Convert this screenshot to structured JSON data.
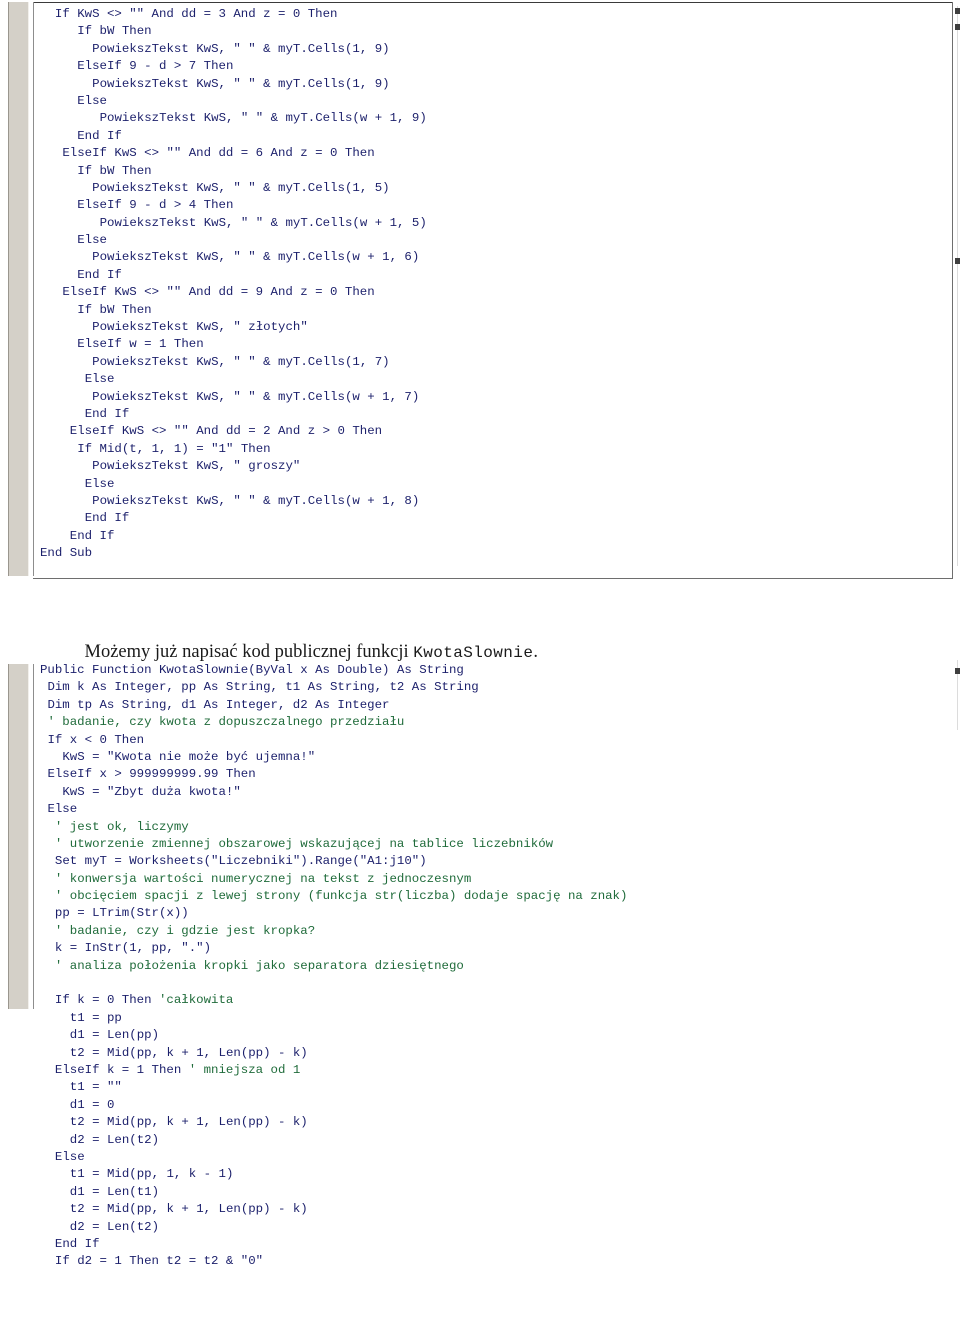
{
  "document": {
    "kind": "scanned-page",
    "language": "pl",
    "background_color": "#ffffff",
    "margin_strip_color": "#d4d0c8",
    "code_color": "#16195c",
    "comment_color": "#1f6b3a"
  },
  "code_block_1": {
    "name": "vba-listing-kwota-slownie-tail",
    "language": "VBA",
    "lines": [
      [
        {
          "t": "If KwS <> \"\" And dd = 3 And z = 0 Then",
          "c": "kw",
          "indent": 2
        }
      ],
      [
        {
          "t": "If bW Then",
          "c": "kw",
          "indent": 5
        }
      ],
      [
        {
          "t": "PowiekszTekst KwS, \" \" & myT.Cells(1, 9)",
          "c": "plain",
          "indent": 7
        }
      ],
      [
        {
          "t": "ElseIf 9 - d > 7 Then",
          "c": "kw",
          "indent": 5
        }
      ],
      [
        {
          "t": "PowiekszTekst KwS, \" \" & myT.Cells(1, 9)",
          "c": "plain",
          "indent": 7
        }
      ],
      [
        {
          "t": "Else",
          "c": "kw",
          "indent": 5
        }
      ],
      [
        {
          "t": "PowiekszTekst KwS, \" \" & myT.Cells(w + 1, 9)",
          "c": "plain",
          "indent": 8
        }
      ],
      [
        {
          "t": "End If",
          "c": "kw",
          "indent": 5
        }
      ],
      [
        {
          "t": "ElseIf KwS <> \"\" And dd = 6 And z = 0 Then",
          "c": "kw",
          "indent": 3
        }
      ],
      [
        {
          "t": "If bW Then",
          "c": "kw",
          "indent": 5
        }
      ],
      [
        {
          "t": "PowiekszTekst KwS, \" \" & myT.Cells(1, 5)",
          "c": "plain",
          "indent": 7
        }
      ],
      [
        {
          "t": "ElseIf 9 - d > 4 Then",
          "c": "kw",
          "indent": 5
        }
      ],
      [
        {
          "t": "PowiekszTekst KwS, \" \" & myT.Cells(w + 1, 5)",
          "c": "plain",
          "indent": 8
        }
      ],
      [
        {
          "t": "Else",
          "c": "kw",
          "indent": 5
        }
      ],
      [
        {
          "t": "PowiekszTekst KwS, \" \" & myT.Cells(w + 1, 6)",
          "c": "plain",
          "indent": 7
        }
      ],
      [
        {
          "t": "End If",
          "c": "kw",
          "indent": 5
        }
      ],
      [
        {
          "t": "ElseIf KwS <> \"\" And dd = 9 And z = 0 Then",
          "c": "kw",
          "indent": 3
        }
      ],
      [
        {
          "t": "If bW Then",
          "c": "kw",
          "indent": 5
        }
      ],
      [
        {
          "t": "PowiekszTekst KwS, \" złotych\"",
          "c": "plain",
          "indent": 7
        }
      ],
      [
        {
          "t": "ElseIf w = 1 Then",
          "c": "kw",
          "indent": 5
        }
      ],
      [
        {
          "t": "PowiekszTekst KwS, \" \" & myT.Cells(1, 7)",
          "c": "plain",
          "indent": 7
        }
      ],
      [
        {
          "t": "Else",
          "c": "kw",
          "indent": 6
        }
      ],
      [
        {
          "t": "PowiekszTekst KwS, \" \" & myT.Cells(w + 1, 7)",
          "c": "plain",
          "indent": 7
        }
      ],
      [
        {
          "t": "End If",
          "c": "kw",
          "indent": 6
        }
      ],
      [
        {
          "t": "ElseIf KwS <> \"\" And dd = 2 And z > 0 Then",
          "c": "kw",
          "indent": 4
        }
      ],
      [
        {
          "t": "If Mid(t, 1, 1) = \"1\" Then",
          "c": "kw",
          "indent": 5
        }
      ],
      [
        {
          "t": "PowiekszTekst KwS, \" groszy\"",
          "c": "plain",
          "indent": 7
        }
      ],
      [
        {
          "t": "Else",
          "c": "kw",
          "indent": 6
        }
      ],
      [
        {
          "t": "PowiekszTekst KwS, \" \" & myT.Cells(w + 1, 8)",
          "c": "plain",
          "indent": 7
        }
      ],
      [
        {
          "t": "End If",
          "c": "kw",
          "indent": 6
        }
      ],
      [
        {
          "t": "End If",
          "c": "kw",
          "indent": 4
        }
      ],
      [
        {
          "t": "End Sub",
          "c": "kw",
          "indent": 0
        }
      ]
    ]
  },
  "paragraph": {
    "name": "intro-paragraph",
    "text_before": "Możemy już napisać kod publicznej funkcji ",
    "code_span": "KwotaSlownie",
    "text_after": "."
  },
  "code_block_2": {
    "name": "vba-listing-kwota-slownie-head",
    "language": "VBA",
    "lines": [
      [
        {
          "t": "Public Function KwotaSlownie(ByVal x As Double) As String",
          "c": "kw",
          "indent": 0
        }
      ],
      [
        {
          "t": "Dim k As Integer, pp As String, t1 As String, t2 As String",
          "c": "kw",
          "indent": 1
        }
      ],
      [
        {
          "t": "Dim tp As String, d1 As Integer, d2 As Integer",
          "c": "kw",
          "indent": 1
        }
      ],
      [
        {
          "t": "' badanie, czy kwota z dopuszczalnego przedziału",
          "c": "comment",
          "indent": 1
        }
      ],
      [
        {
          "t": "If x < 0 Then",
          "c": "kw",
          "indent": 1
        }
      ],
      [
        {
          "t": "KwS = \"Kwota nie może być ujemna!\"",
          "c": "plain",
          "indent": 3
        }
      ],
      [
        {
          "t": "ElseIf x > 999999999.99 Then",
          "c": "kw",
          "indent": 1
        }
      ],
      [
        {
          "t": "KwS = \"Zbyt duża kwota!\"",
          "c": "plain",
          "indent": 3
        }
      ],
      [
        {
          "t": "Else",
          "c": "kw",
          "indent": 1
        }
      ],
      [
        {
          "t": "' jest ok, liczymy",
          "c": "comment",
          "indent": 2
        }
      ],
      [
        {
          "t": "' utworzenie zmiennej obszarowej wskazującej na tablice liczebników",
          "c": "comment",
          "indent": 2
        }
      ],
      [
        {
          "t": "Set myT = Worksheets(\"Liczebniki\").Range(\"A1:j10\")",
          "c": "plain",
          "indent": 2
        }
      ],
      [
        {
          "t": "' konwersja wartości numerycznej na tekst z jednoczesnym",
          "c": "comment",
          "indent": 2
        }
      ],
      [
        {
          "t": "' obcięciem spacji z lewej strony (funkcja str(liczba) dodaje spację na znak)",
          "c": "comment",
          "indent": 2
        }
      ],
      [
        {
          "t": "pp = LTrim(Str(x))",
          "c": "plain",
          "indent": 2
        }
      ],
      [
        {
          "t": "' badanie, czy i gdzie jest kropka?",
          "c": "comment",
          "indent": 2
        }
      ],
      [
        {
          "t": "k = InStr(1, pp, \".\")",
          "c": "plain",
          "indent": 2
        }
      ],
      [
        {
          "t": "' analiza położenia kropki jako separatora dziesiętnego",
          "c": "comment",
          "indent": 2
        }
      ],
      [
        {
          "t": "",
          "c": "plain",
          "indent": 0
        }
      ],
      [
        {
          "t": "If k = 0 Then ",
          "c": "kw",
          "indent": 2
        },
        {
          "t": "'całkowita",
          "c": "comment",
          "indent": 0
        }
      ],
      [
        {
          "t": "t1 = pp",
          "c": "plain",
          "indent": 4
        }
      ],
      [
        {
          "t": "d1 = Len(pp)",
          "c": "plain",
          "indent": 4
        }
      ],
      [
        {
          "t": "t2 = Mid(pp, k + 1, Len(pp) - k)",
          "c": "plain",
          "indent": 4
        }
      ],
      [
        {
          "t": "ElseIf k = 1 Then ",
          "c": "kw",
          "indent": 2
        },
        {
          "t": "' mniejsza od 1",
          "c": "comment",
          "indent": 0
        }
      ],
      [
        {
          "t": "t1 = \"\"",
          "c": "plain",
          "indent": 4
        }
      ],
      [
        {
          "t": "d1 = 0",
          "c": "plain",
          "indent": 4
        }
      ],
      [
        {
          "t": "t2 = Mid(pp, k + 1, Len(pp) - k)",
          "c": "plain",
          "indent": 4
        }
      ],
      [
        {
          "t": "d2 = Len(t2)",
          "c": "plain",
          "indent": 4
        }
      ],
      [
        {
          "t": "Else",
          "c": "kw",
          "indent": 2
        }
      ],
      [
        {
          "t": "t1 = Mid(pp, 1, k - 1)",
          "c": "plain",
          "indent": 4
        }
      ],
      [
        {
          "t": "d1 = Len(t1)",
          "c": "plain",
          "indent": 4
        }
      ],
      [
        {
          "t": "t2 = Mid(pp, k + 1, Len(pp) - k)",
          "c": "plain",
          "indent": 4
        }
      ],
      [
        {
          "t": "d2 = Len(t2)",
          "c": "plain",
          "indent": 4
        }
      ],
      [
        {
          "t": "End If",
          "c": "kw",
          "indent": 2
        }
      ],
      [
        {
          "t": "If d2 = 1 Then t2 = t2 & \"0\"",
          "c": "kw",
          "indent": 2
        }
      ]
    ]
  }
}
